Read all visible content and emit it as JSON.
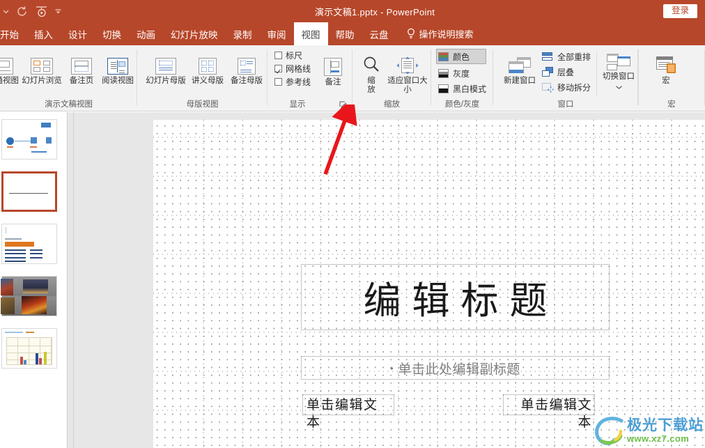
{
  "titlebar": {
    "document_title": "演示文稿1.pptx  -  PowerPoint",
    "login_label": "登录",
    "qat": [
      {
        "name": "autosave-chevron-icon",
        "glyph": "⌄"
      },
      {
        "name": "undo-icon",
        "glyph": "↺"
      },
      {
        "name": "start-slideshow-icon",
        "glyph": "▷"
      },
      {
        "name": "customize-qat-chevron-icon",
        "glyph": "▾"
      }
    ],
    "brand_color": "#b7472a"
  },
  "tabs": [
    {
      "label": "开始",
      "active": false,
      "clipped": true
    },
    {
      "label": "插入",
      "active": false
    },
    {
      "label": "设计",
      "active": false
    },
    {
      "label": "切换",
      "active": false
    },
    {
      "label": "动画",
      "active": false
    },
    {
      "label": "幻灯片放映",
      "active": false
    },
    {
      "label": "录制",
      "active": false
    },
    {
      "label": "审阅",
      "active": false
    },
    {
      "label": "视图",
      "active": true
    },
    {
      "label": "帮助",
      "active": false
    },
    {
      "label": "云盘",
      "active": false
    }
  ],
  "tell_me": {
    "label": "操作说明搜索",
    "icon": "lightbulb-icon"
  },
  "ribbon": {
    "groups": [
      {
        "name": "presentation-views",
        "label": "演示文稿视图",
        "buttons": [
          {
            "label": "普通视图",
            "icon": "normal-view-icon",
            "clipped": true
          },
          {
            "label": "幻灯片浏览",
            "icon": "slide-sorter-icon"
          },
          {
            "label": "备注页",
            "icon": "notes-page-icon"
          },
          {
            "label": "阅读视图",
            "icon": "reading-view-icon"
          }
        ]
      },
      {
        "name": "master-views",
        "label": "母版视图",
        "buttons": [
          {
            "label": "幻灯片母版",
            "icon": "slide-master-icon"
          },
          {
            "label": "讲义母版",
            "icon": "handout-master-icon"
          },
          {
            "label": "备注母版",
            "icon": "notes-master-icon"
          }
        ]
      },
      {
        "name": "show",
        "label": "显示",
        "has_launcher": true,
        "checkboxes": [
          {
            "label": "标尺",
            "checked": false
          },
          {
            "label": "网格线",
            "checked": true
          },
          {
            "label": "参考线",
            "checked": false
          }
        ],
        "buttons": [
          {
            "label": "备注",
            "icon": "notes-pane-icon"
          }
        ]
      },
      {
        "name": "zoom",
        "label": "缩放",
        "buttons": [
          {
            "label": "缩放",
            "icon": "zoom-magnifier-icon"
          },
          {
            "label": "适应窗口大小",
            "icon": "fit-to-window-icon"
          }
        ]
      },
      {
        "name": "color-grayscale",
        "label": "颜色/灰度",
        "options": [
          {
            "label": "颜色",
            "selected": true,
            "icon": "color-swatch-icon"
          },
          {
            "label": "灰度",
            "selected": false,
            "icon": "grayscale-swatch-icon"
          },
          {
            "label": "黑白模式",
            "selected": false,
            "icon": "blackwhite-swatch-icon"
          }
        ]
      },
      {
        "name": "window",
        "label": "窗口",
        "buttons": [
          {
            "label": "新建窗口",
            "icon": "new-window-icon"
          },
          {
            "label": "切换窗口",
            "icon": "switch-windows-icon",
            "has_dropdown": true
          }
        ],
        "small_buttons": [
          {
            "label": "全部重排",
            "icon": "arrange-all-icon"
          },
          {
            "label": "层叠",
            "icon": "cascade-icon"
          },
          {
            "label": "移动拆分",
            "icon": "move-split-icon"
          }
        ]
      },
      {
        "name": "macros",
        "label": "宏",
        "buttons": [
          {
            "label": "宏",
            "icon": "macro-icon"
          }
        ]
      }
    ]
  },
  "thumbnails": [
    {
      "index": 1,
      "selected": false,
      "kind": "diagram"
    },
    {
      "index": 2,
      "selected": true,
      "kind": "title-line"
    },
    {
      "index": 3,
      "selected": false,
      "kind": "text-orange"
    },
    {
      "index": 4,
      "selected": false,
      "kind": "photo-grid"
    },
    {
      "index": 5,
      "selected": false,
      "kind": "chart"
    }
  ],
  "slide": {
    "title": "编辑标题",
    "subtitle": "单击此处编辑副标题",
    "textbox_left": "单击编辑文本",
    "textbox_right": "单击编辑文本"
  },
  "annotation": {
    "type": "red-arrow",
    "points_to": "显示 group dialog launcher",
    "color": "#e8161a"
  },
  "watermark": {
    "main": "极光下载站",
    "sub": "www.xz7.com",
    "main_color": "#4d9fd4",
    "sub_color": "#6cbf4a"
  }
}
